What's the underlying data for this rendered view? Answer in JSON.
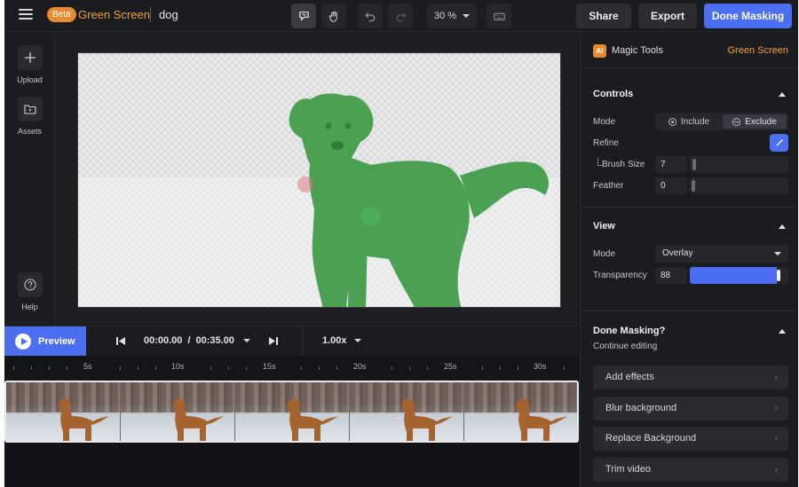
{
  "topbar": {
    "beta_badge": "Beta",
    "app_title": "Green Screen",
    "doc_name": "dog",
    "zoom_value": "30 %",
    "share_label": "Share",
    "export_label": "Export",
    "done_label": "Done Masking",
    "tools": [
      "mask-tool-icon",
      "hand-tool-icon",
      "undo-icon",
      "redo-icon",
      "keyboard-icon"
    ]
  },
  "rail": {
    "upload_label": "Upload",
    "assets_label": "Assets",
    "help_label": "Help"
  },
  "playback": {
    "preview_label": "Preview",
    "current_time": "00:00.00",
    "separator": "/",
    "total_time": "00:35.00",
    "speed": "1.00x"
  },
  "ruler": {
    "labels": [
      "5s",
      "10s",
      "15s",
      "20s",
      "25s",
      "30s"
    ]
  },
  "panel": {
    "ai_badge": "AI",
    "title": "Magic Tools",
    "mode_tag": "Green Screen",
    "controls": {
      "title": "Controls",
      "mode_label": "Mode",
      "include_label": "Include",
      "exclude_label": "Exclude",
      "selected_mode": "Exclude",
      "refine_label": "Refine",
      "brush_label": "Brush Size",
      "brush_value": "7",
      "brush_fraction": 0.03,
      "feather_label": "Feather",
      "feather_value": "0",
      "feather_fraction": 0.0
    },
    "view": {
      "title": "View",
      "mode_label": "Mode",
      "mode_value": "Overlay",
      "transparency_label": "Transparency",
      "transparency_value": "88",
      "transparency_fraction": 0.88
    },
    "done": {
      "title": "Done Masking?",
      "subtitle": "Continue editing",
      "actions": [
        "Add effects",
        "Blur background",
        "Replace Background",
        "Trim video"
      ]
    }
  },
  "colors": {
    "accent_blue": "#4c6ef0",
    "brand_orange": "#e98a2e",
    "mask_green": "#3e9a45"
  }
}
